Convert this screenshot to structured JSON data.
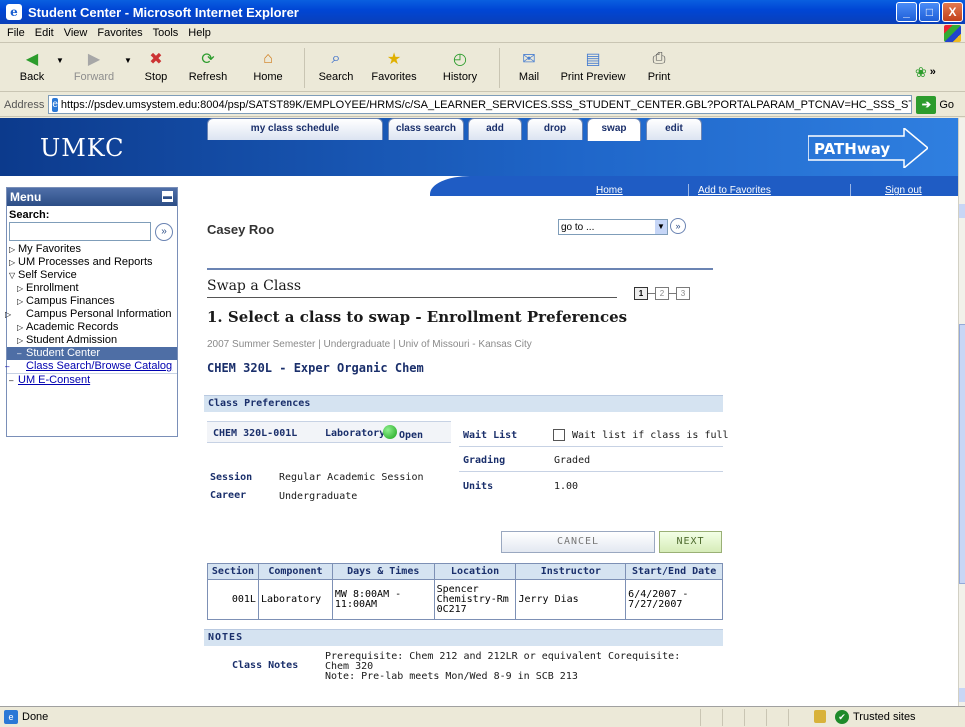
{
  "window": {
    "title": "Student Center - Microsoft Internet Explorer",
    "buttons": {
      "minimize": "_",
      "maximize": "□",
      "close": "X"
    }
  },
  "menubar": [
    "File",
    "Edit",
    "View",
    "Favorites",
    "Tools",
    "Help"
  ],
  "toolbar": {
    "back": "Back",
    "forward": "Forward",
    "stop": "Stop",
    "refresh": "Refresh",
    "home": "Home",
    "search": "Search",
    "favorites": "Favorites",
    "history": "History",
    "mail": "Mail",
    "print_preview": "Print Preview",
    "print": "Print",
    "more": "»"
  },
  "address": {
    "label": "Address",
    "url": "https://psdev.umsystem.edu:8004/psp/SATST89K/EMPLOYEE/HRMS/c/SA_LEARNER_SERVICES.SSS_STUDENT_CENTER.GBL?PORTALPARAM_PTCNAV=HC_SSS_STUDENT_CENTER&",
    "go": "Go"
  },
  "banner": {
    "logo": "UMKC",
    "pathway": "PATHway"
  },
  "topnav": {
    "home": "Home",
    "add_favorites": "Add to Favorites",
    "sign_out": "Sign out"
  },
  "menu": {
    "title": "Menu",
    "search_label": "Search:",
    "items": [
      {
        "label": "My Favorites"
      },
      {
        "label": "UM Processes and Reports"
      },
      {
        "label": "Self Service"
      },
      {
        "label": "Enrollment"
      },
      {
        "label": "Campus Finances"
      },
      {
        "label": "Campus Personal Information"
      },
      {
        "label": "Academic Records"
      },
      {
        "label": "Student Admission"
      },
      {
        "label": "Student Center"
      },
      {
        "label": "Class Search/Browse Catalog"
      },
      {
        "label": "UM E-Consent"
      }
    ]
  },
  "student": {
    "name": "Casey Roo"
  },
  "goto": {
    "value": "go to ..."
  },
  "tabs": [
    "my class schedule",
    "class search",
    "add",
    "drop",
    "swap",
    "edit"
  ],
  "page": {
    "swap_title": "Swap a Class",
    "steps": [
      "1",
      "2",
      "3"
    ],
    "select_title": "1.  Select a class to swap - Enrollment Preferences",
    "term": "2007 Summer Semester | Undergraduate | Univ of Missouri - Kansas City",
    "course": "CHEM  320L - Exper Organic Chem"
  },
  "prefs": {
    "head": "Class Preferences",
    "class_nbr": "CHEM 320L-001L",
    "component": "Laboratory",
    "status": "Open",
    "session_label": "Session",
    "session_value": "Regular Academic Session",
    "career_label": "Career",
    "career_value": "Undergraduate",
    "waitlist_label": "Wait List",
    "waitlist_value": "Wait list if class is full",
    "grading_label": "Grading",
    "grading_value": "Graded",
    "units_label": "Units",
    "units_value": "1.00"
  },
  "buttons": {
    "cancel": "CANCEL",
    "next": "NEXT"
  },
  "table": {
    "headers": [
      "Section",
      "Component",
      "Days & Times",
      "Location",
      "Instructor",
      "Start/End Date"
    ],
    "rows": [
      [
        "001L",
        "Laboratory",
        "MW 8:00AM - 11:00AM",
        "Spencer Chemistry-Rm 0C217",
        "Jerry Dias",
        "6/4/2007 - 7/27/2007"
      ]
    ]
  },
  "notes": {
    "head": "NOTES",
    "label": "Class Notes",
    "text": "Prerequisite: Chem 212 and 212LR or equivalent   Corequisite: Chem 320",
    "text2": "Note: Pre-lab meets Mon/Wed 8-9 in SCB 213"
  },
  "status": {
    "done": "Done",
    "zone": "Trusted sites"
  },
  "colors": {
    "brand_blue": "#1f5cc4",
    "header_blue": "#0a3fb8",
    "open_green": "#1aa31a"
  }
}
